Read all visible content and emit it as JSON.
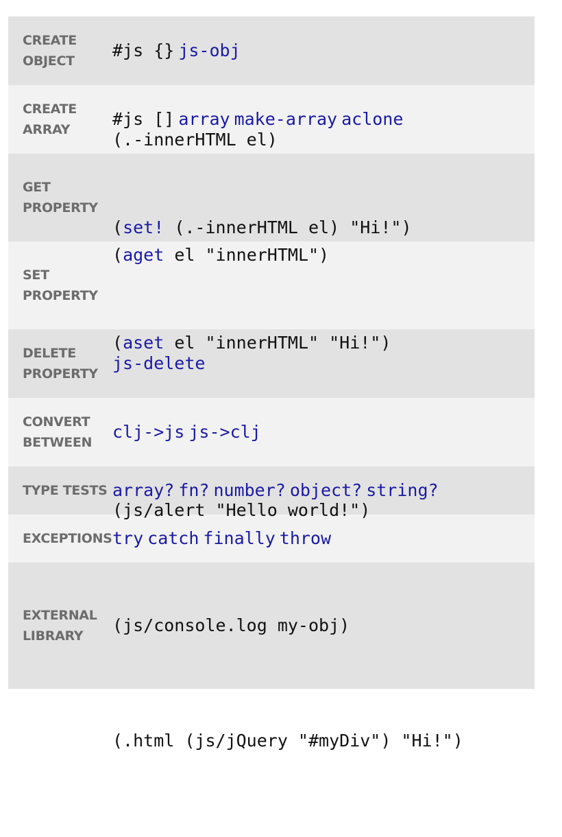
{
  "colors": {
    "link": "#1a1aa6",
    "text": "#111111",
    "label": "#6c6c6c",
    "row_dark": "#e2e2e2",
    "row_light": "#f2f2f2"
  },
  "rows": [
    {
      "label": [
        "CREATE",
        "OBJECT"
      ],
      "lines": [
        [
          "#js {}",
          "js-obj"
        ]
      ]
    },
    {
      "label": [
        "CREATE",
        "ARRAY"
      ],
      "lines": [
        [
          "#js []",
          "array",
          "make-array",
          "aclone"
        ]
      ]
    },
    {
      "label": [
        "GET",
        "PROPERTY"
      ],
      "lines": [
        [
          "(.-innerHTML el)"
        ],
        [
          "(",
          "aget",
          " el \"innerHTML\")"
        ]
      ]
    },
    {
      "label": [
        "SET",
        "PROPERTY"
      ],
      "lines": [
        [
          "(",
          "set!",
          " (.-innerHTML el) \"Hi!\")"
        ],
        [
          "(",
          "aset",
          " el \"innerHTML\" \"Hi!\")"
        ]
      ]
    },
    {
      "label": [
        "DELETE",
        "PROPERTY"
      ],
      "lines": [
        [
          "js-delete"
        ]
      ]
    },
    {
      "label": [
        "CONVERT",
        "BETWEEN"
      ],
      "lines": [
        [
          "clj->js",
          "js->clj"
        ]
      ]
    },
    {
      "label": [
        "TYPE TESTS"
      ],
      "lines": [
        [
          "array?",
          "fn?",
          "number?",
          "object?",
          "string?"
        ]
      ]
    },
    {
      "label": [
        "EXCEPTIONS"
      ],
      "lines": [
        [
          "try",
          "catch",
          "finally",
          "throw"
        ]
      ]
    },
    {
      "label": [
        "EXTERNAL",
        "LIBRARY"
      ],
      "lines": [
        [
          "(js/alert \"Hello world!\")"
        ],
        [
          "(js/console.log my-obj)"
        ],
        [
          "(.html (js/jQuery \"#myDiv\") \"Hi!\")"
        ]
      ]
    }
  ]
}
